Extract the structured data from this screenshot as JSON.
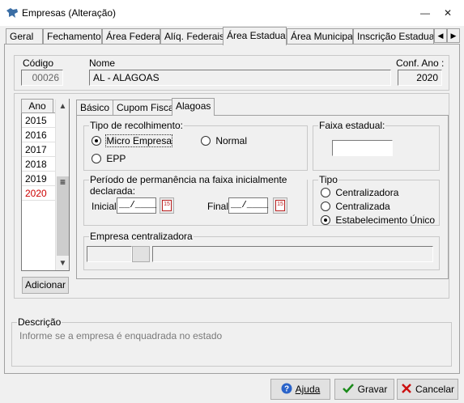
{
  "window": {
    "title": "Empresas (Alteração)",
    "minimize_icon": "minimize-icon",
    "close_icon": "close-icon"
  },
  "tabs": [
    {
      "label": "Geral"
    },
    {
      "label": "Fechamento"
    },
    {
      "label": "Área Federal"
    },
    {
      "label": "Alíq. Federais"
    },
    {
      "label": "Área Estadual"
    },
    {
      "label": "Área Municipal"
    },
    {
      "label": "Inscrição Estadual S"
    }
  ],
  "active_tab": "Área Estadual",
  "header": {
    "codigo_label": "Código",
    "codigo_value": "00026",
    "nome_label": "Nome",
    "nome_value": "AL - ALAGOAS",
    "conf_ano_label": "Conf. Ano :",
    "conf_ano_value": "2020"
  },
  "years": {
    "column_header": "Ano",
    "rows": [
      "2015",
      "2016",
      "2017",
      "2018",
      "2019",
      "2020"
    ],
    "selected": "2020",
    "selected_color": "#cc0000",
    "add_button": "Adicionar"
  },
  "inner_tabs": [
    {
      "label": "Básico"
    },
    {
      "label": "Cupom Fiscal"
    },
    {
      "label": "Alagoas"
    }
  ],
  "active_inner_tab": "Alagoas",
  "recolhimento": {
    "legend": "Tipo de recolhimento:",
    "options": [
      "Micro Empresa",
      "Normal",
      "EPP"
    ],
    "selected": "Micro Empresa"
  },
  "faixa": {
    "legend": "Faixa estadual:",
    "value": ""
  },
  "periodo": {
    "legend": "Período de permanência na faixa inicialmente declarada:",
    "inicial_label": "Inicial",
    "inicial_value": "__/____",
    "final_label": "Final",
    "final_value": "__/____",
    "calendar_icon_text": "15"
  },
  "tipo": {
    "legend": "Tipo",
    "options": [
      "Centralizadora",
      "Centralizada",
      "Estabelecimento Único"
    ],
    "selected": "Estabelecimento Único"
  },
  "centralizadora": {
    "legend": "Empresa centralizadora"
  },
  "descricao": {
    "legend": "Descrição",
    "text": "Informe se a empresa é enquadrada no estado"
  },
  "buttons": {
    "ajuda": "Ajuda",
    "gravar": "Gravar",
    "cancelar": "Cancelar"
  }
}
